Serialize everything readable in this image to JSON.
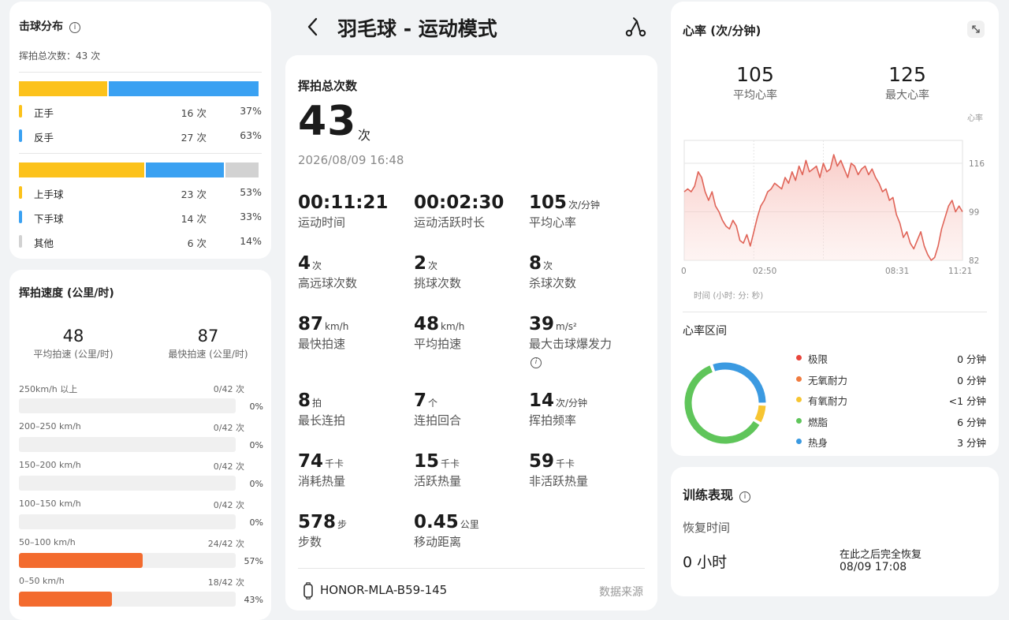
{
  "hit_distribution": {
    "title": "击球分布",
    "total_label": "挥拍总次数：43 次",
    "hand": [
      {
        "name": "正手",
        "count": "16 次",
        "pct": "37%",
        "fraction": 0.37,
        "color": "#fcc21b"
      },
      {
        "name": "反手",
        "count": "27 次",
        "pct": "63%",
        "fraction": 0.63,
        "color": "#3aa1f2"
      }
    ],
    "stroke": [
      {
        "name": "上手球",
        "count": "23 次",
        "pct": "53%",
        "fraction": 0.53,
        "color": "#fcc21b"
      },
      {
        "name": "下手球",
        "count": "14 次",
        "pct": "33%",
        "fraction": 0.33,
        "color": "#3aa1f2"
      },
      {
        "name": "其他",
        "count": "6 次",
        "pct": "14%",
        "fraction": 0.14,
        "color": "#d2d2d2"
      }
    ]
  },
  "swing_speed": {
    "title": "挥拍速度 (公里/时)",
    "avg_value": "48",
    "avg_label": "平均拍速 (公里/时)",
    "max_value": "87",
    "max_label": "最快拍速 (公里/时)",
    "ranges": [
      {
        "range": "250km/h 以上",
        "count": "0/42 次",
        "pct": "0%",
        "fraction": 0
      },
      {
        "range": "200–250 km/h",
        "count": "0/42 次",
        "pct": "0%",
        "fraction": 0
      },
      {
        "range": "150–200 km/h",
        "count": "0/42 次",
        "pct": "0%",
        "fraction": 0
      },
      {
        "range": "100–150 km/h",
        "count": "0/42 次",
        "pct": "0%",
        "fraction": 0
      },
      {
        "range": "50–100 km/h",
        "count": "24/42 次",
        "pct": "57%",
        "fraction": 0.57
      },
      {
        "range": "0–50 km/h",
        "count": "18/42 次",
        "pct": "43%",
        "fraction": 0.43
      }
    ]
  },
  "header": {
    "title": "羽毛球 - 运动模式"
  },
  "summary": {
    "total_label": "挥拍总次数",
    "total_value": "43",
    "total_unit": "次",
    "datetime": "2026/08/09 16:48",
    "metrics": [
      {
        "value": "00:11:21",
        "unit": "",
        "label": "运动时间"
      },
      {
        "value": "00:02:30",
        "unit": "",
        "label": "运动活跃时长"
      },
      {
        "value": "105",
        "unit": "次/分钟",
        "label": "平均心率"
      },
      {
        "value": "4",
        "unit": "次",
        "label": "高远球次数"
      },
      {
        "value": "2",
        "unit": "次",
        "label": "挑球次数"
      },
      {
        "value": "8",
        "unit": "次",
        "label": "杀球次数"
      },
      {
        "value": "87",
        "unit": "km/h",
        "label": "最快拍速"
      },
      {
        "value": "48",
        "unit": "km/h",
        "label": "平均拍速"
      },
      {
        "value": "39",
        "unit": "m/s²",
        "label": "最大击球爆发力"
      },
      {
        "value": "8",
        "unit": "拍",
        "label": "最长连拍"
      },
      {
        "value": "7",
        "unit": "个",
        "label": "连拍回合"
      },
      {
        "value": "14",
        "unit": "次/分钟",
        "label": "挥拍频率"
      },
      {
        "value": "74",
        "unit": "千卡",
        "label": "消耗热量"
      },
      {
        "value": "15",
        "unit": "千卡",
        "label": "活跃热量"
      },
      {
        "value": "59",
        "unit": "千卡",
        "label": "非活跃热量"
      },
      {
        "value": "578",
        "unit": "步",
        "label": "步数"
      },
      {
        "value": "0.45",
        "unit": "公里",
        "label": "移动距离"
      }
    ],
    "device": "HONOR-MLA-B59-145",
    "data_source": "数据来源"
  },
  "heart_rate": {
    "title": "心率 (次/分钟)",
    "avg_value": "105",
    "avg_label": "平均心率",
    "max_value": "125",
    "max_label": "最大心率",
    "zone_title": "心率区间",
    "zones": [
      {
        "name": "极限",
        "value": "0 分钟",
        "color": "#e8453c"
      },
      {
        "name": "无氧耐力",
        "value": "0 分钟",
        "color": "#f07b3f"
      },
      {
        "name": "有氧耐力",
        "value": "<1 分钟",
        "color": "#f7c531"
      },
      {
        "name": "燃脂",
        "value": "6 分钟",
        "color": "#5fc55a"
      },
      {
        "name": "热身",
        "value": "3 分钟",
        "color": "#3b9ae1"
      }
    ],
    "donut_fractions": {
      "warmup": 0.31,
      "aerobic": 0.08,
      "fatburn": 0.61
    }
  },
  "chart_data": {
    "type": "line",
    "title": "",
    "xlabel": "时间 (小时: 分: 秒)",
    "ylabel": "心率",
    "x_ticks": [
      "0",
      "02:50",
      "08:31",
      "11:21"
    ],
    "y_ticks": [
      82,
      99,
      116
    ],
    "ylim": [
      82,
      124
    ],
    "xlim": [
      0,
      681
    ],
    "grid": true,
    "series": [
      {
        "values": [
          106,
          107,
          106,
          108,
          113,
          111,
          106,
          103,
          106,
          101,
          99,
          96,
          94,
          93,
          96,
          94,
          89,
          88,
          91,
          87,
          92,
          97,
          101,
          103,
          106,
          107,
          109,
          108,
          107,
          111,
          109,
          113,
          110,
          115,
          112,
          117,
          113,
          114,
          115,
          111,
          116,
          113,
          114,
          119,
          115,
          117,
          114,
          111,
          116,
          115,
          112,
          114,
          115,
          112,
          114,
          111,
          109,
          106,
          107,
          103,
          104,
          98,
          95,
          90,
          92,
          88,
          86,
          89,
          92,
          87,
          84,
          82,
          83,
          87,
          93,
          97,
          101,
          103,
          99,
          101,
          99
        ]
      }
    ],
    "color": "#e06458"
  },
  "training": {
    "title": "训练表现",
    "recovery_label": "恢复时间",
    "recovery_value": "0 小时",
    "recovery_note": "在此之后完全恢复",
    "recovery_time": "08/09 17:08"
  }
}
